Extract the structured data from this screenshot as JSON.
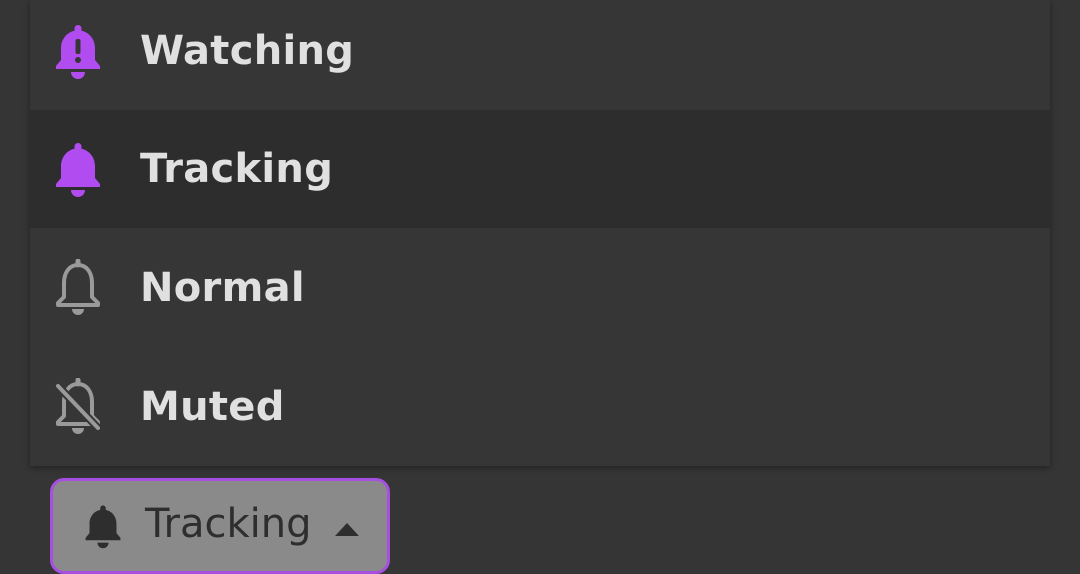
{
  "menu": {
    "items": [
      {
        "label": "Watching",
        "icon": "bell-exclamation-icon",
        "icon_color": "#b14cf0"
      },
      {
        "label": "Tracking",
        "icon": "bell-filled-icon",
        "icon_color": "#b14cf0",
        "selected": true
      },
      {
        "label": "Normal",
        "icon": "bell-outline-icon",
        "icon_color": "#9a9a9a"
      },
      {
        "label": "Muted",
        "icon": "bell-slash-icon",
        "icon_color": "#9a9a9a"
      }
    ]
  },
  "trigger": {
    "label": "Tracking",
    "icon": "bell-filled-icon",
    "caret": "caret-up-icon",
    "border_color": "#a64fe0"
  }
}
